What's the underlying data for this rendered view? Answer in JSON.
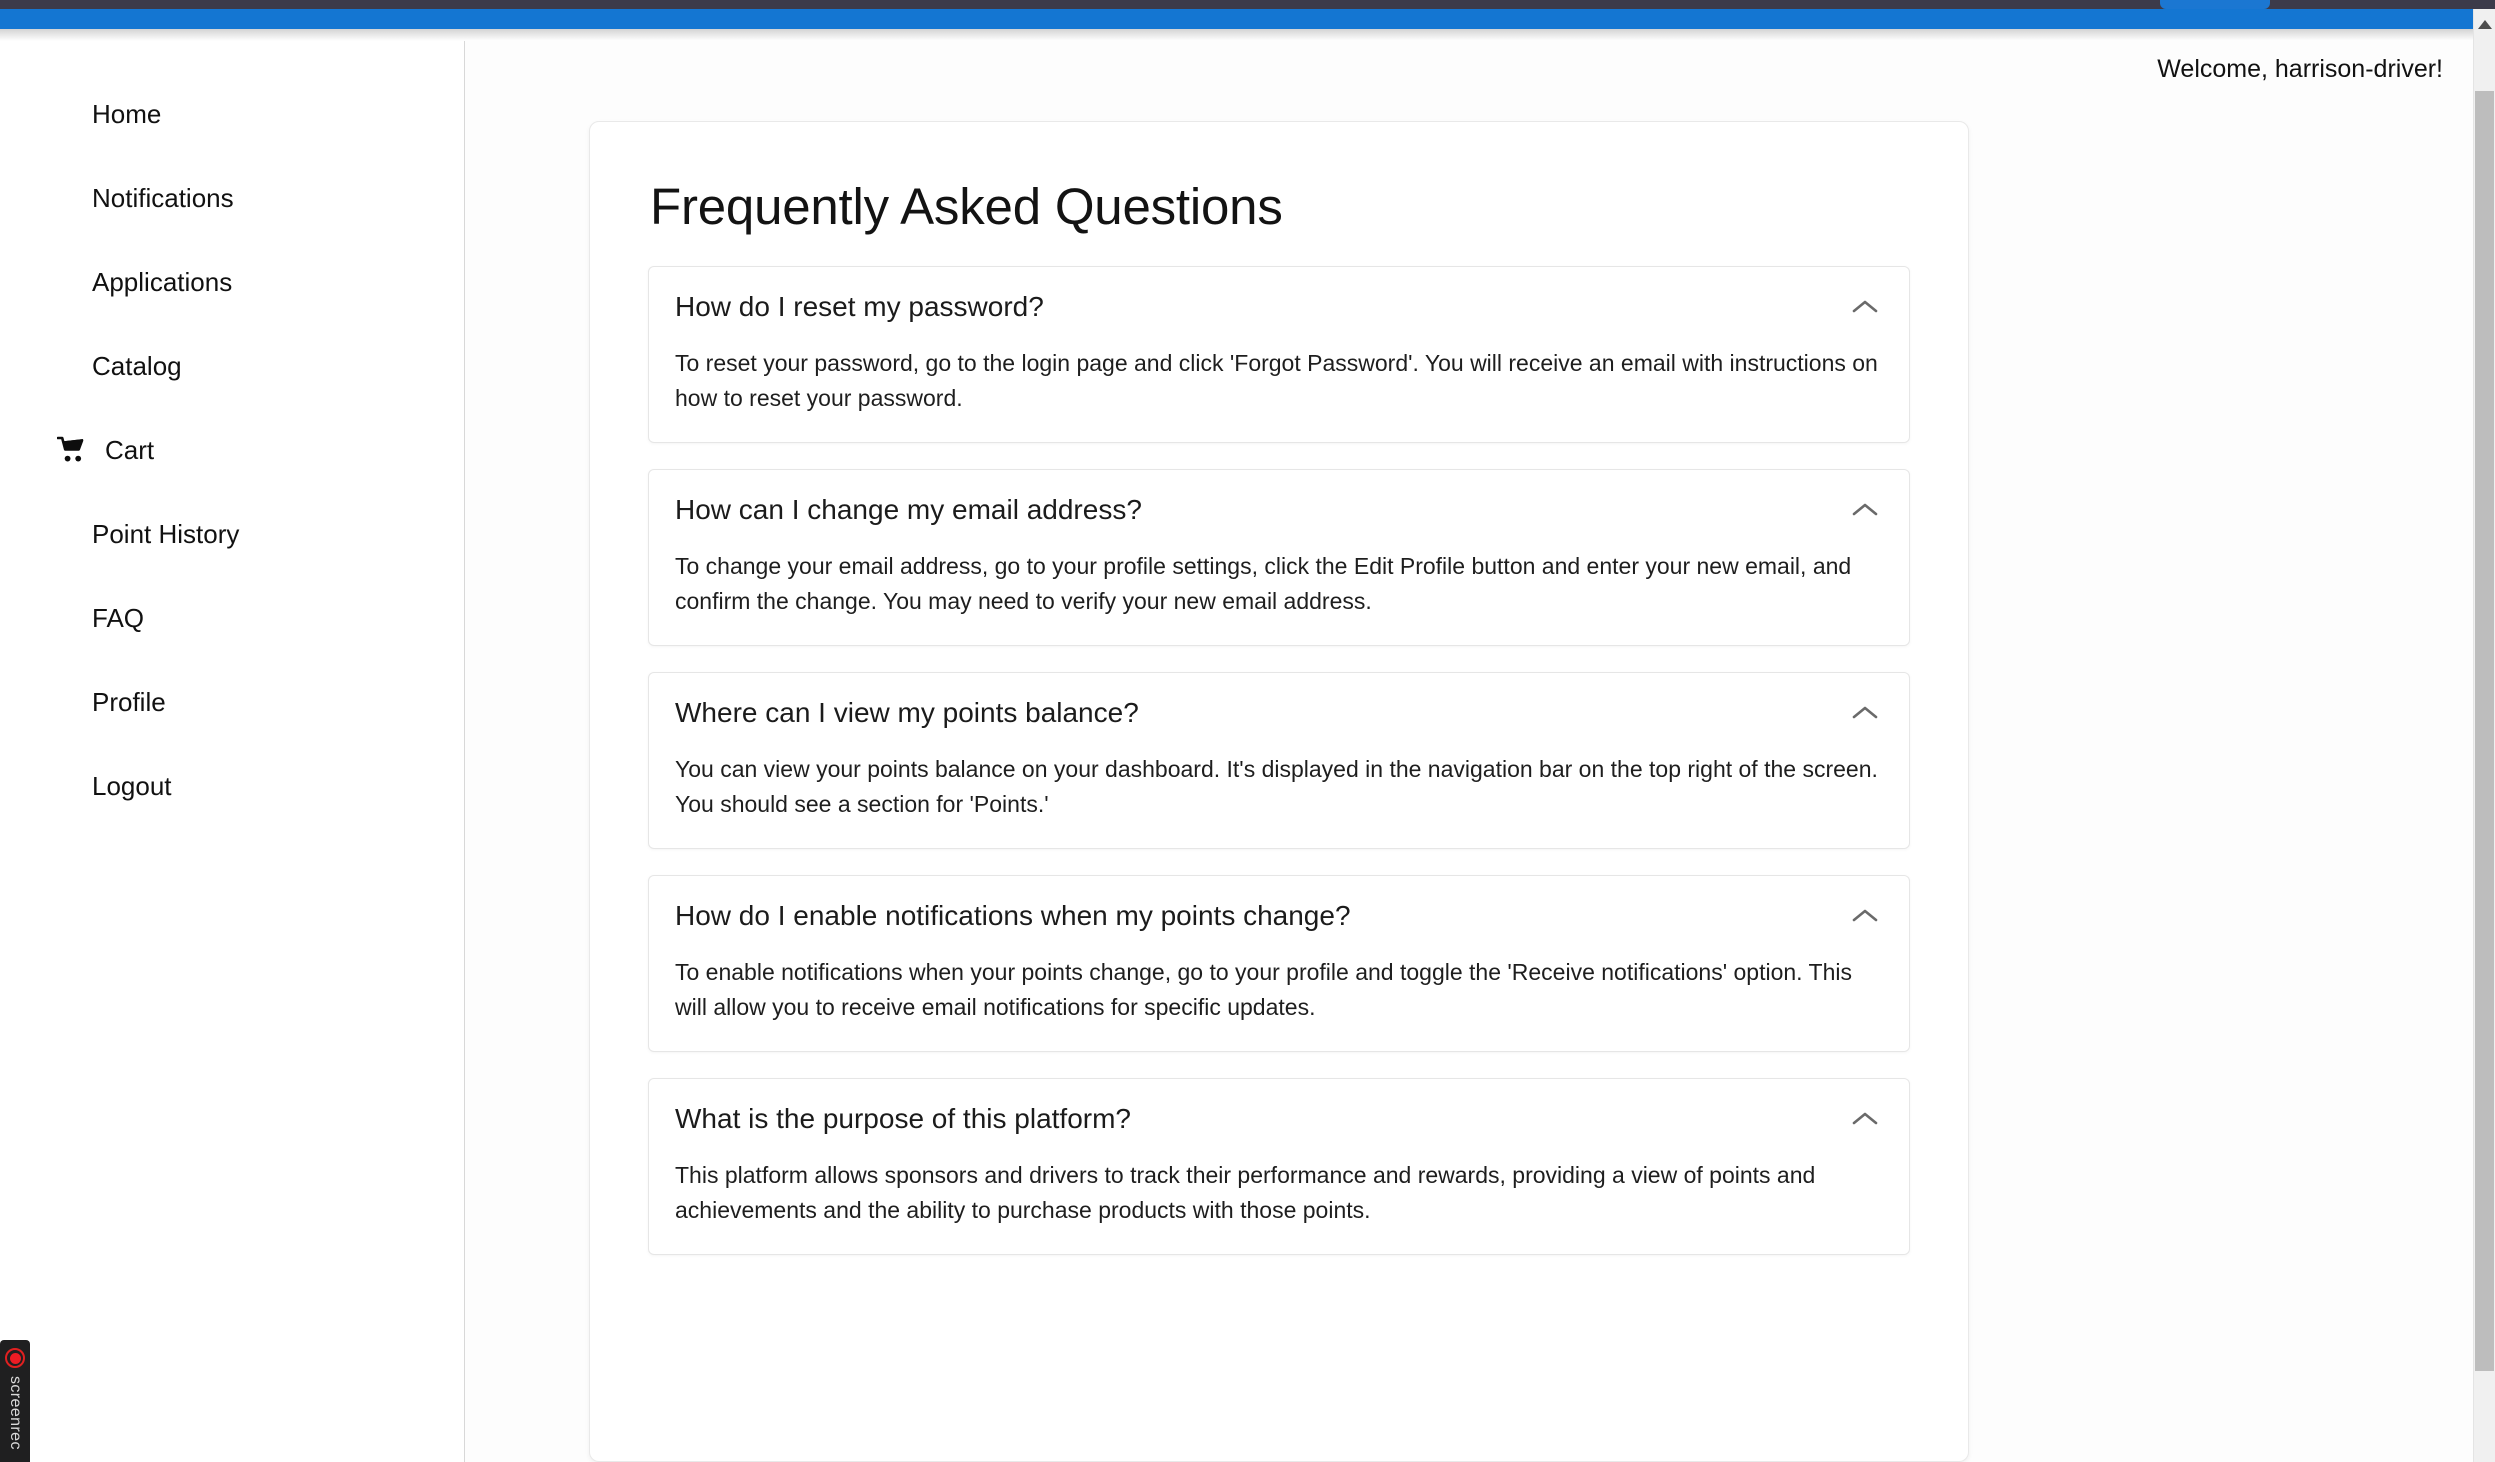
{
  "browser": {
    "accent_color": "#1476d2",
    "chrome_color": "#3c3b4a"
  },
  "scrollbar": {
    "up_arrow_icon": "triangle-up-icon",
    "thumb_color": "#bdbdbd"
  },
  "sidebar": {
    "items": [
      {
        "label": "Home",
        "icon": ""
      },
      {
        "label": "Notifications",
        "icon": ""
      },
      {
        "label": "Applications",
        "icon": ""
      },
      {
        "label": "Catalog",
        "icon": ""
      },
      {
        "label": "Cart",
        "icon": "shopping-cart-icon"
      },
      {
        "label": "Point History",
        "icon": ""
      },
      {
        "label": "FAQ",
        "icon": ""
      },
      {
        "label": "Profile",
        "icon": ""
      },
      {
        "label": "Logout",
        "icon": ""
      }
    ]
  },
  "header": {
    "welcome_text": "Welcome, harrison-driver!",
    "username": "harrison-driver"
  },
  "main": {
    "page_title": "Frequently Asked Questions",
    "faq": [
      {
        "question": "How do I reset my password?",
        "answer": "To reset your password, go to the login page and click 'Forgot Password'. You will receive an email with instructions on how to reset your password.",
        "expanded": true,
        "toggle_icon": "chevron-up-icon"
      },
      {
        "question": "How can I change my email address?",
        "answer": "To change your email address, go to your profile settings, click the Edit Profile button and enter your new email, and confirm the change. You may need to verify your new email address.",
        "expanded": true,
        "toggle_icon": "chevron-up-icon"
      },
      {
        "question": "Where can I view my points balance?",
        "answer": "You can view your points balance on your dashboard. It's displayed in the navigation bar on the top right of the screen. You should see a section for 'Points.'",
        "expanded": true,
        "toggle_icon": "chevron-up-icon"
      },
      {
        "question": "How do I enable notifications when my points change?",
        "answer": "To enable notifications when your points change, go to your profile and toggle the 'Receive notifications' option. This will allow you to receive email notifications for specific updates.",
        "expanded": true,
        "toggle_icon": "chevron-up-icon"
      },
      {
        "question": "What is the purpose of this platform?",
        "answer": "This platform allows sponsors and drivers to track their performance and rewards, providing a view of points and achievements and the ability to purchase products with those points.",
        "expanded": true,
        "toggle_icon": "chevron-up-icon"
      }
    ]
  },
  "recorder": {
    "label": "screenrec",
    "record_icon": "record-dot-icon"
  }
}
